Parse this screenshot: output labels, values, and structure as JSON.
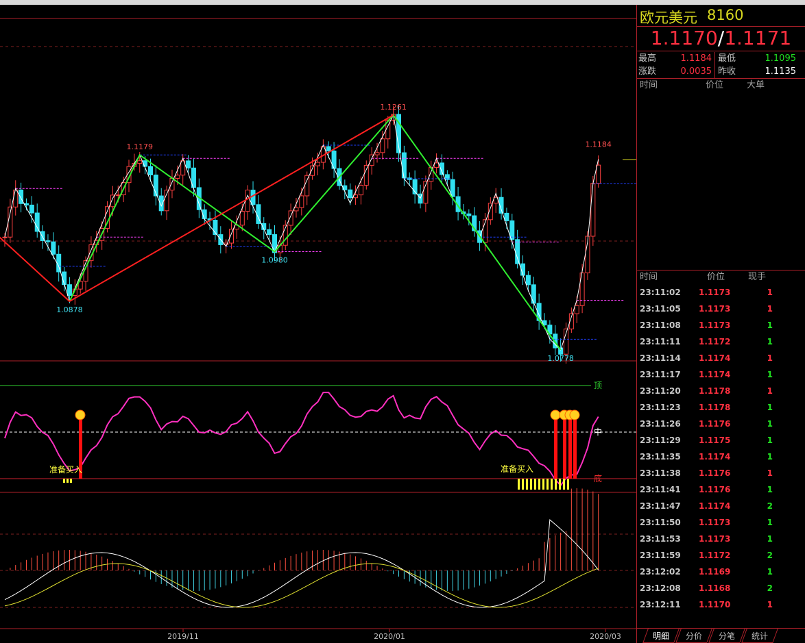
{
  "header": {
    "symbol": "欧元美元",
    "code": "8160",
    "bid": "1.1170",
    "sep": "/",
    "ask": "1.1171"
  },
  "stats": {
    "high_label": "最高",
    "high": "1.1184",
    "low_label": "最低",
    "low": "1.1095",
    "change_label": "涨跌",
    "change": "0.0035",
    "prev_label": "昨收",
    "prev": "1.1135"
  },
  "big_orders": {
    "headers": [
      "时间",
      "价位",
      "大单"
    ]
  },
  "ticks": {
    "headers": [
      "时间",
      "价位",
      "现手"
    ],
    "rows": [
      [
        "23:11:02",
        "1.1173",
        "1",
        "up"
      ],
      [
        "23:11:05",
        "1.1173",
        "1",
        "up"
      ],
      [
        "23:11:08",
        "1.1173",
        "1",
        "down"
      ],
      [
        "23:11:11",
        "1.1172",
        "1",
        "down"
      ],
      [
        "23:11:14",
        "1.1174",
        "1",
        "up"
      ],
      [
        "23:11:17",
        "1.1174",
        "1",
        "down"
      ],
      [
        "23:11:20",
        "1.1178",
        "1",
        "up"
      ],
      [
        "23:11:23",
        "1.1178",
        "1",
        "down"
      ],
      [
        "23:11:26",
        "1.1176",
        "1",
        "down"
      ],
      [
        "23:11:29",
        "1.1175",
        "1",
        "down"
      ],
      [
        "23:11:35",
        "1.1174",
        "1",
        "down"
      ],
      [
        "23:11:38",
        "1.1176",
        "1",
        "up"
      ],
      [
        "23:11:41",
        "1.1176",
        "1",
        "down"
      ],
      [
        "23:11:47",
        "1.1174",
        "2",
        "down"
      ],
      [
        "23:11:50",
        "1.1173",
        "1",
        "down"
      ],
      [
        "23:11:53",
        "1.1173",
        "1",
        "down"
      ],
      [
        "23:11:59",
        "1.1172",
        "2",
        "down"
      ],
      [
        "23:12:02",
        "1.1169",
        "1",
        "down"
      ],
      [
        "23:12:08",
        "1.1168",
        "2",
        "down"
      ],
      [
        "23:12:11",
        "1.1170",
        "1",
        "up"
      ]
    ]
  },
  "tabs": [
    "明细",
    "分价",
    "分笔",
    "统计"
  ],
  "chart_data": {
    "type": "candlestick",
    "price_range": [
      1.07,
      1.13
    ],
    "keypoints": [
      [
        0,
        1.101
      ],
      [
        2,
        1.111
      ],
      [
        6,
        1.103
      ],
      [
        10,
        1.095
      ],
      [
        12,
        1.0878
      ],
      [
        17,
        1.101
      ],
      [
        20,
        1.109
      ],
      [
        25,
        1.1179
      ],
      [
        29,
        1.1074
      ],
      [
        33,
        1.1172
      ],
      [
        37,
        1.1047
      ],
      [
        41,
        1.0991
      ],
      [
        45,
        1.1096
      ],
      [
        50,
        1.098
      ],
      [
        55,
        1.1103
      ],
      [
        59,
        1.1199
      ],
      [
        64,
        1.108
      ],
      [
        68,
        1.1172
      ],
      [
        72,
        1.1261
      ],
      [
        74,
        1.113
      ],
      [
        77,
        1.109
      ],
      [
        80,
        1.1172
      ],
      [
        83,
        1.109
      ],
      [
        88,
        1.101
      ],
      [
        91,
        1.11
      ],
      [
        94,
        1.1
      ],
      [
        97,
        1.09
      ],
      [
        101,
        1.08
      ],
      [
        103,
        1.0778
      ],
      [
        106,
        1.088
      ],
      [
        108,
        1.1
      ],
      [
        109,
        1.112
      ],
      [
        110,
        1.117
      ]
    ],
    "annotations": [
      {
        "label": "1.1261",
        "i": 72,
        "p": 1.1261
      },
      {
        "label": "1.1179",
        "i": 25,
        "p": 1.1179
      },
      {
        "label": "1.1184",
        "i": 110,
        "p": 1.1184
      },
      {
        "label": "1.0878",
        "i": 12,
        "p": 1.0878
      },
      {
        "label": "1.0980",
        "i": 50,
        "p": 1.098
      },
      {
        "label": "1.0778",
        "i": 103,
        "p": 1.0778
      }
    ],
    "red_zigzag": [
      [
        -1,
        1.101
      ],
      [
        12,
        1.0878
      ],
      [
        72,
        1.1261
      ]
    ],
    "green_zigzag": [
      [
        12,
        1.0878
      ],
      [
        25,
        1.1179
      ],
      [
        50,
        1.098
      ],
      [
        72,
        1.1261
      ],
      [
        103,
        1.0778
      ]
    ],
    "indicator": {
      "top_label": "顶",
      "mid_label": "中",
      "bottom_label": "底",
      "signal_label": "准备买入",
      "signal_label2": "准备买入"
    },
    "x_labels": [
      "2019/11",
      "2020/01",
      "2020/03"
    ]
  }
}
